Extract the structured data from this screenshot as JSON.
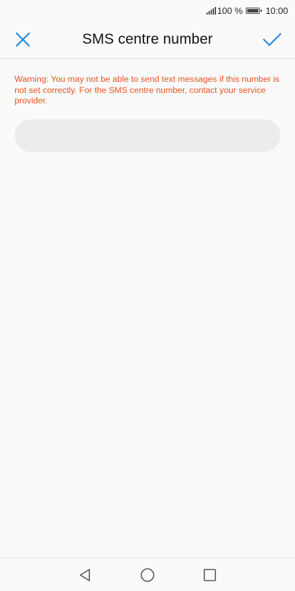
{
  "status_bar": {
    "battery_percent": "100 %",
    "time": "10:00",
    "signal_icon": "signal-icon",
    "battery_icon": "battery-icon"
  },
  "toolbar": {
    "title": "SMS centre number",
    "close_icon": "close-icon",
    "confirm_icon": "check-icon",
    "accent_color": "#1e88e5"
  },
  "content": {
    "warning_text": "Warning: You may not be able to send text messages if this number is not set correctly. For the SMS centre number, contact your service provider.",
    "warning_color": "#e8531f",
    "sms_number_value": "",
    "sms_number_placeholder": ""
  },
  "nav_bar": {
    "back_icon": "back-triangle-icon",
    "home_icon": "home-circle-icon",
    "recents_icon": "recents-square-icon"
  }
}
